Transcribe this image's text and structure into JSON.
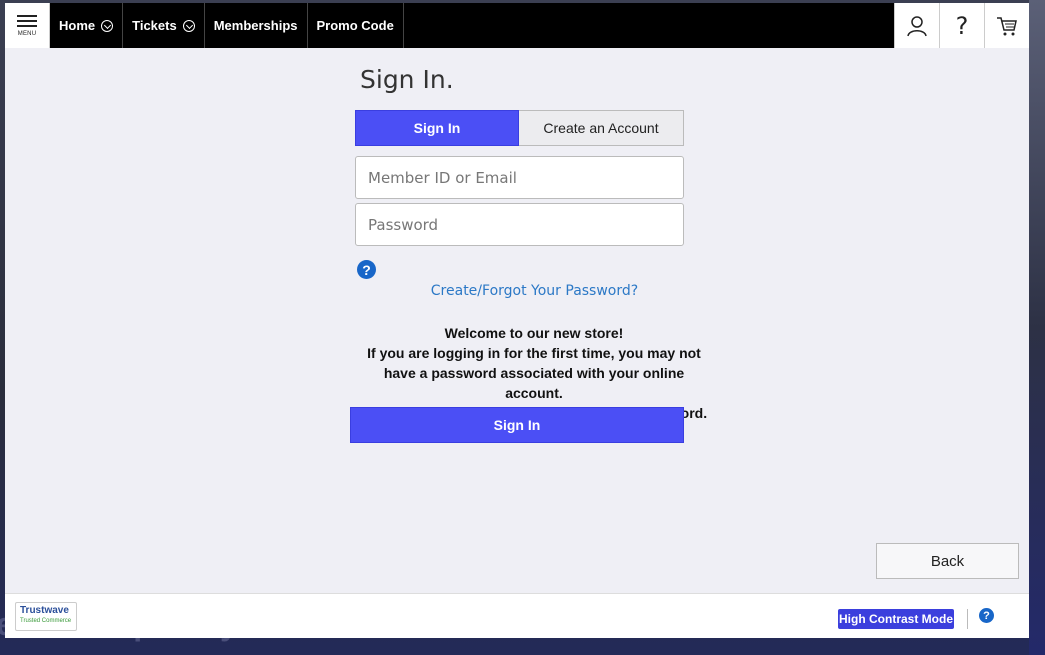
{
  "nav": {
    "menu_label": "MENU",
    "items": [
      {
        "label": "Home",
        "has_dropdown": true
      },
      {
        "label": "Tickets",
        "has_dropdown": true
      },
      {
        "label": "Memberships",
        "has_dropdown": false
      },
      {
        "label": "Promo Code",
        "has_dropdown": false
      }
    ],
    "right_icons": [
      "user-icon",
      "help-question-icon",
      "cart-icon"
    ],
    "help_glyph": "?"
  },
  "page": {
    "title": "Sign In.",
    "tabs": [
      {
        "label": "Sign In",
        "active": true
      },
      {
        "label": "Create an Account",
        "active": false
      }
    ],
    "member_field": {
      "placeholder": "Member ID or Email",
      "value": ""
    },
    "password_field": {
      "placeholder": "Password",
      "value": ""
    },
    "help_glyph": "?",
    "forgot_link": "Create/Forgot Your Password?",
    "welcome_lines": [
      "Welcome to our new store!",
      "If you are logging in for the first time, you may not",
      "have a password associated with your online account.",
      "Please click the link above to create your password."
    ],
    "signin_button": "Sign In",
    "back_button": "Back"
  },
  "footer": {
    "trust_title": "Trustwave",
    "trust_sub": "Trusted Commerce",
    "high_contrast": "High Contrast Mode",
    "help_glyph": "?"
  },
  "background": {
    "partial_text": "e of Temporary Closure"
  },
  "colors": {
    "accent": "#4b4ff5",
    "link": "#2b78c6",
    "nav_bg": "#000000",
    "modal_bg": "#efeff5"
  }
}
